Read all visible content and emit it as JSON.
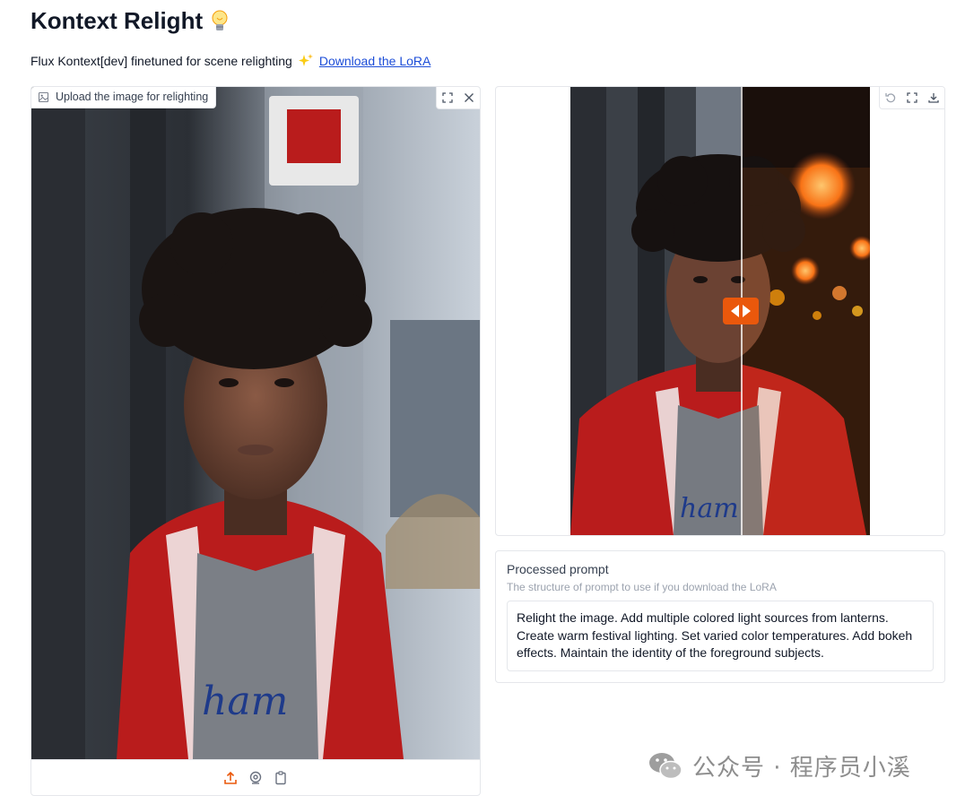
{
  "header": {
    "title": "Kontext Relight",
    "title_icon": "lightbulb-emoji",
    "subtitle": "Flux Kontext[dev] finetuned for scene relighting",
    "subtitle_icon": "sparkles-emoji",
    "download_link": "Download the LoRA"
  },
  "input_image": {
    "label": "Upload the image for relighting",
    "label_icon": "image-icon",
    "tools": [
      "fullscreen-icon",
      "close-icon"
    ],
    "source_tools": [
      "upload-icon",
      "webcam-icon",
      "clipboard-icon"
    ]
  },
  "output_image": {
    "tools": [
      "undo-icon",
      "fullscreen-icon",
      "download-icon"
    ],
    "slider_position": 0.57
  },
  "prompt": {
    "label": "Processed prompt",
    "info": "The structure of prompt to use if you download the LoRA",
    "value": "Relight the image. Add multiple colored light sources from lanterns. Create warm festival lighting. Set varied color temperatures. Add bokeh effects. Maintain the identity of the foreground subjects."
  },
  "watermark": {
    "icon": "wechat-icon",
    "text": "公众号 · 程序员小溪"
  },
  "colors": {
    "accent": "#ea580c",
    "link": "#1d4ed8",
    "border": "#e5e7eb",
    "jacket_red": "#b91c1c"
  }
}
